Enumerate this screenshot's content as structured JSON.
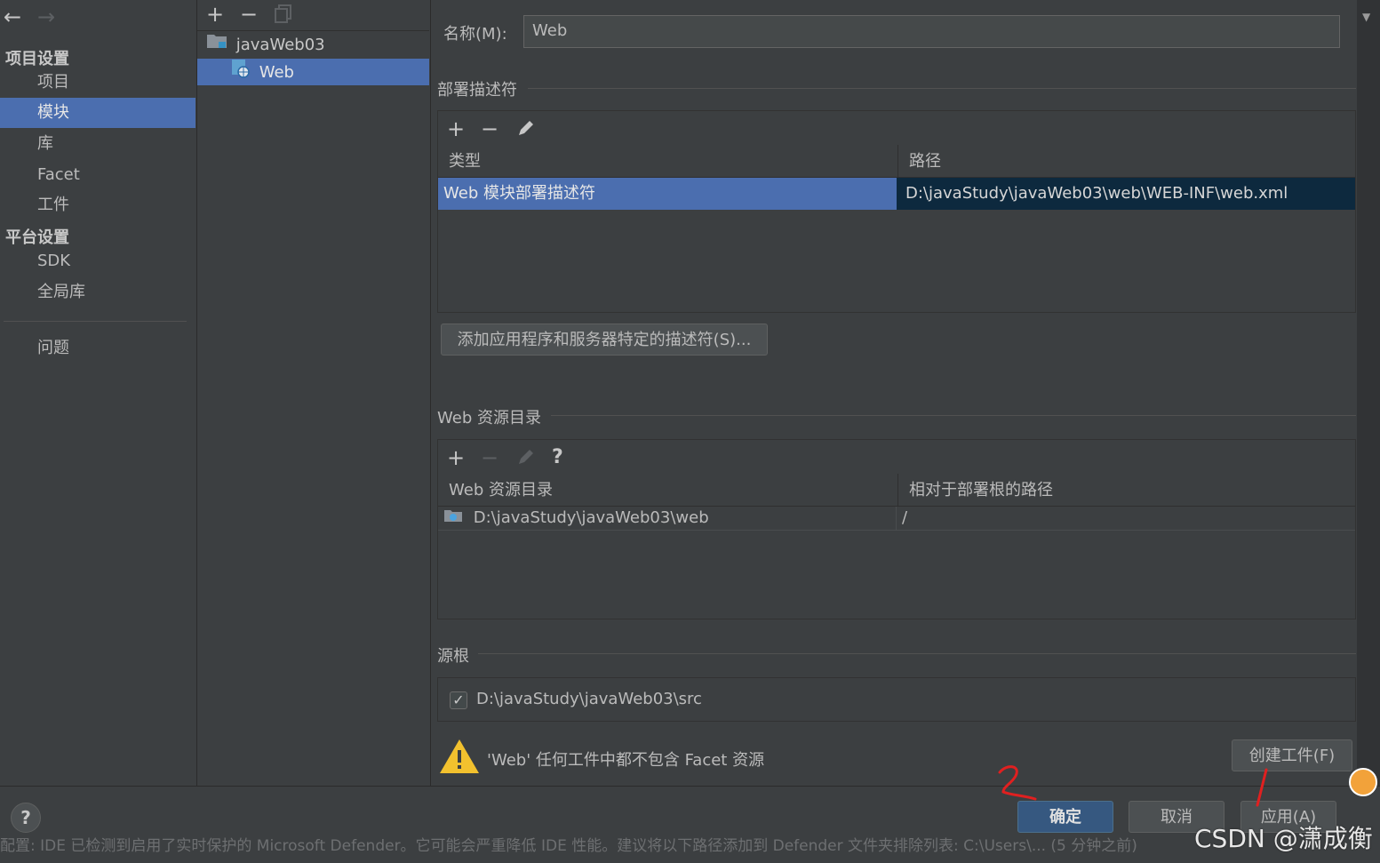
{
  "nav": {
    "back_icon": "arrow-left-icon",
    "forward_icon": "arrow-right-icon",
    "section_project": "项目设置",
    "items_project": [
      "项目",
      "模块",
      "库",
      "Facet",
      "工件"
    ],
    "section_platform": "平台设置",
    "items_platform": [
      "SDK",
      "全局库"
    ],
    "problems": "问题",
    "selected": "模块"
  },
  "tree": {
    "toolbar": [
      "add-icon",
      "remove-icon",
      "copy-icon"
    ],
    "root": "javaWeb03",
    "child": "Web"
  },
  "main": {
    "name_label": "名称(M):",
    "name_value": "Web",
    "deploy_section": "部署描述符",
    "deploy_table": {
      "headers": [
        "类型",
        "路径"
      ],
      "rows": [
        [
          "Web 模块部署描述符",
          "D:\\javaStudy\\javaWeb03\\web\\WEB-INF\\web.xml"
        ]
      ]
    },
    "add_descriptor_button": "添加应用程序和服务器特定的描述符(S)...",
    "web_resource_section": "Web 资源目录",
    "web_resource_table": {
      "headers": [
        "Web 资源目录",
        "相对于部署根的路径"
      ],
      "rows": [
        [
          "D:\\javaStudy\\javaWeb03\\web",
          "/"
        ]
      ]
    },
    "help_glyph": "?",
    "source_section": "源根",
    "source_root": "D:\\javaStudy\\javaWeb03\\src",
    "source_checked": true,
    "warning_text": "'Web' 任何工件中都不包含 Facet 资源",
    "create_artifact_button": "创建工件(F)"
  },
  "footer": {
    "help": "?",
    "ok": "确定",
    "cancel": "取消",
    "apply": "应用(A)"
  },
  "watermark": "CSDN @潇成衡",
  "status_text": "配置: IDE 已检测到启用了实时保护的 Microsoft Defender。它可能会严重降低 IDE 性能。建议将以下路径添加到 Defender 文件夹排除列表: C:\\Users\\... (5 分钟之前)",
  "annotations": [
    "2",
    "1"
  ],
  "colors": {
    "selection": "#4b6eaf",
    "background": "#3c3f41",
    "primary_button": "#365880",
    "annotation_red": "#e02020",
    "warning_yellow": "#f2c12e"
  }
}
